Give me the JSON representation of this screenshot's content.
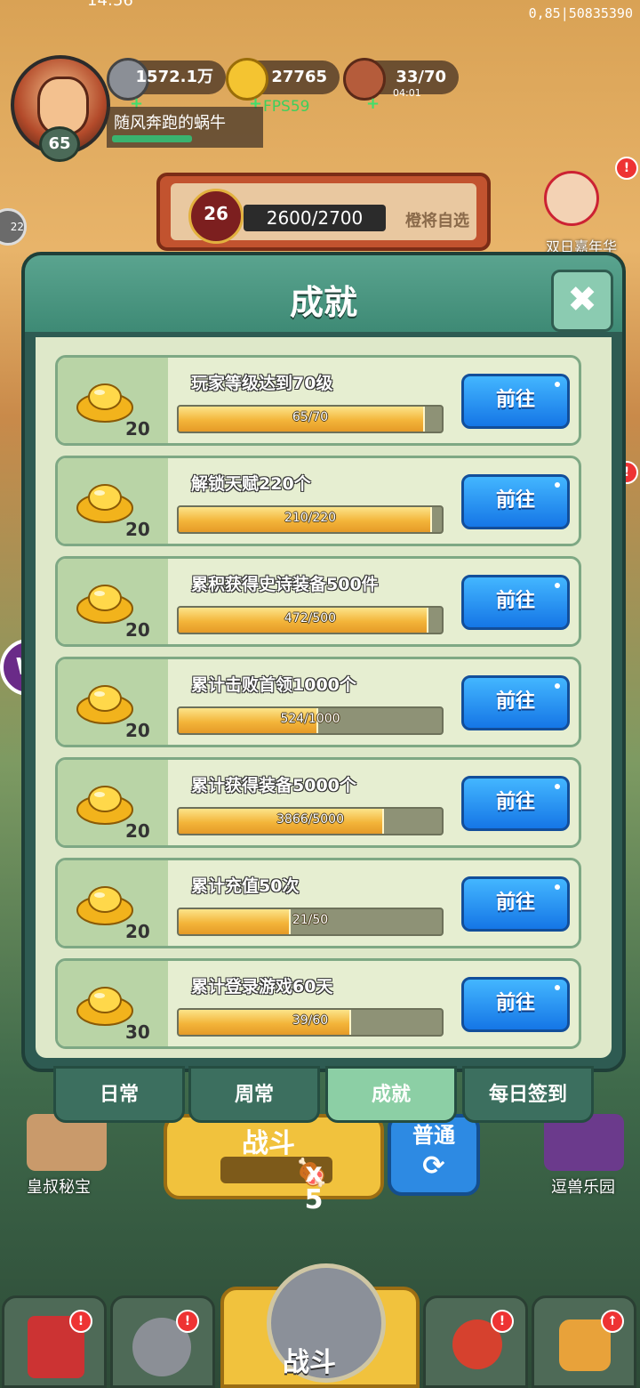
{
  "status_bar": {
    "time": "14:56",
    "network": "0,85|50835390"
  },
  "player": {
    "level": "65",
    "name": "随风奔跑的蜗牛"
  },
  "resources": [
    {
      "icon": "silver-coin-icon",
      "value": "1572.1万"
    },
    {
      "icon": "gold-ingot-icon",
      "value": "27765"
    },
    {
      "icon": "meat-icon",
      "value": "33/70"
    }
  ],
  "energy_timer": "04:01",
  "fps": "FPS59",
  "battle_pass": {
    "level": "26",
    "progress": "2600/2700",
    "pick_label": "橙将自选"
  },
  "side_events": {
    "right_top": "双日嘉年华",
    "left_mid": "22"
  },
  "modal": {
    "title": "成就",
    "close_label": "✖",
    "go_label": "前往",
    "rows": [
      {
        "task": "玩家等级达到70级",
        "reward": "20",
        "current": 65,
        "target": 70,
        "progress_text": "65/70"
      },
      {
        "task": "解锁天赋220个",
        "reward": "20",
        "current": 210,
        "target": 220,
        "progress_text": "210/220"
      },
      {
        "task": "累积获得史诗装备500件",
        "reward": "20",
        "current": 472,
        "target": 500,
        "progress_text": "472/500"
      },
      {
        "task": "累计击败首领1000个",
        "reward": "20",
        "current": 524,
        "target": 1000,
        "progress_text": "524/1000"
      },
      {
        "task": "累计获得装备5000个",
        "reward": "20",
        "current": 3866,
        "target": 5000,
        "progress_text": "3866/5000"
      },
      {
        "task": "累计充值50次",
        "reward": "20",
        "current": 21,
        "target": 50,
        "progress_text": "21/50"
      },
      {
        "task": "累计登录游戏60天",
        "reward": "30",
        "current": 39,
        "target": 60,
        "progress_text": "39/60"
      }
    ]
  },
  "tabs": [
    {
      "label": "日常",
      "active": false
    },
    {
      "label": "周常",
      "active": false
    },
    {
      "label": "成就",
      "active": true
    },
    {
      "label": "每日签到",
      "active": false
    }
  ],
  "background": {
    "battle_button": "战斗",
    "battle_cost": "x 5",
    "normal_label": "普通",
    "left_feature": "皇叔秘宝",
    "right_feature": "逗兽乐园"
  },
  "bottom_nav": {
    "center_label": "战斗"
  },
  "colors": {
    "accent_green": "#3e8a75",
    "go_blue": "#1576e6",
    "progress_gold": "#f3b53a",
    "alert_red": "#e33333"
  }
}
